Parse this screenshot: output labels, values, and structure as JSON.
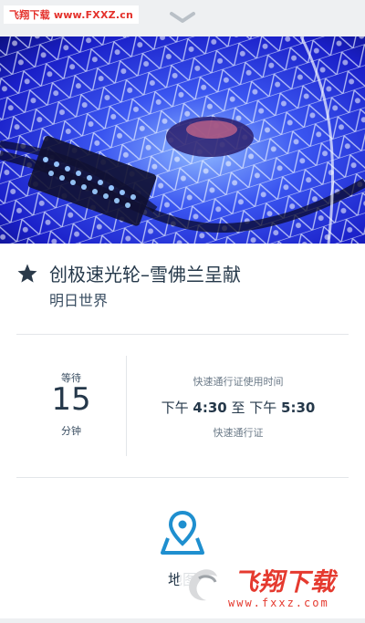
{
  "watermark_top": "飞翔下载 www.FXXZ.cn",
  "attraction": {
    "title": "创极速光轮–雪佛兰呈献",
    "land": "明日世界",
    "favorite_icon": "star-icon"
  },
  "wait": {
    "label": "等待",
    "minutes": "15",
    "unit": "分钟"
  },
  "fastpass": {
    "header": "快速通行证使用时间",
    "prefix1": "下午 ",
    "start": "4:30",
    "separator": " 至 下午 ",
    "end": "5:30",
    "label": "快速通行证"
  },
  "map": {
    "label": "地图",
    "icon": "map-pin-icon"
  },
  "watermark_bottom": {
    "brand": "飞翔下载",
    "url": "www.fxxz.com"
  },
  "colors": {
    "accent": "#1f8fcf",
    "text": "#25384a",
    "star": "#2b3a4a",
    "watermark": "#e53a2f"
  }
}
